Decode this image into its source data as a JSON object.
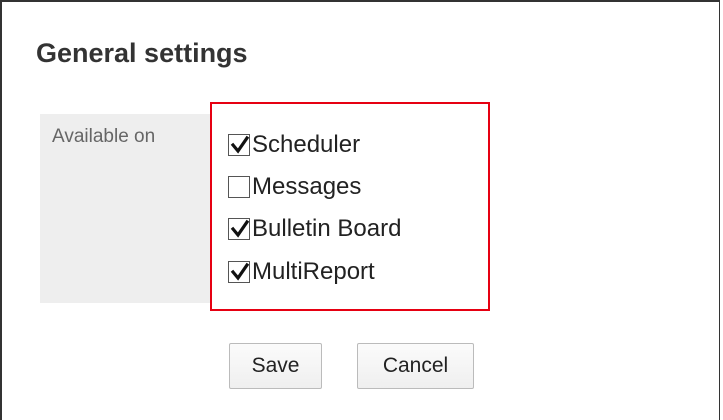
{
  "page": {
    "title": "General settings"
  },
  "form": {
    "field_label": "Available on",
    "options": [
      {
        "label": "Scheduler",
        "checked": true
      },
      {
        "label": "Messages",
        "checked": false
      },
      {
        "label": "Bulletin Board",
        "checked": true
      },
      {
        "label": "MultiReport",
        "checked": true
      }
    ]
  },
  "actions": {
    "save_label": "Save",
    "cancel_label": "Cancel"
  },
  "colors": {
    "highlight_border": "#e60012",
    "label_background": "#eeeeee"
  }
}
